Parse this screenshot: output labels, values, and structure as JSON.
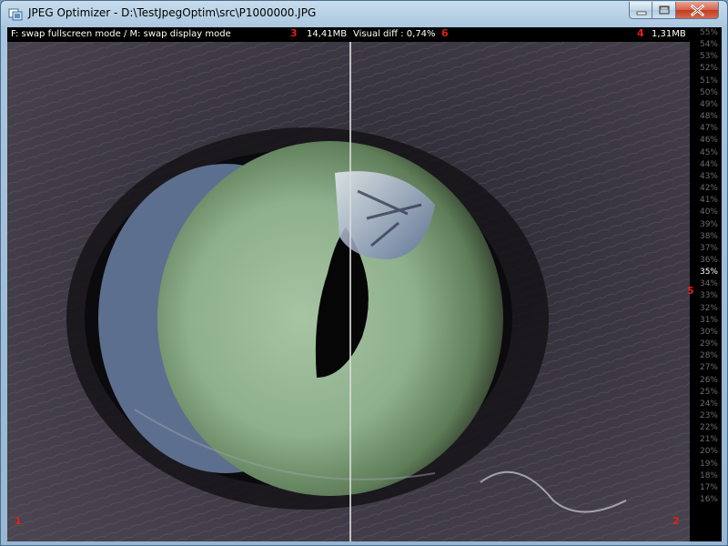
{
  "window": {
    "title": "JPEG Optimizer - D:\\TestJpegOptim\\src\\P1000000.JPG"
  },
  "toolbar": {
    "hint": "F: swap fullscreen mode / M: swap display mode",
    "marker3": "3",
    "original_size": "14,41MB",
    "visual_diff": "Visual diff : 0,74%",
    "marker6": "6",
    "marker4": "4",
    "optimized_size": "1,31MB"
  },
  "quality_scale": {
    "marker5": "5",
    "selected": "35%",
    "ticks": [
      "55%",
      "54%",
      "53%",
      "52%",
      "51%",
      "50%",
      "49%",
      "48%",
      "47%",
      "46%",
      "45%",
      "44%",
      "43%",
      "42%",
      "41%",
      "40%",
      "39%",
      "38%",
      "37%",
      "36%",
      "35%",
      "34%",
      "33%",
      "32%",
      "31%",
      "30%",
      "29%",
      "28%",
      "27%",
      "26%",
      "25%",
      "24%",
      "23%",
      "22%",
      "21%",
      "20%",
      "19%",
      "18%",
      "17%",
      "16%"
    ]
  },
  "image_view": {
    "marker1": "1",
    "marker2": "2"
  },
  "colors": {
    "marker": "#e0201a",
    "tick_inactive": "#6c6c6c",
    "tick_selected": "#ffffff",
    "fur": "#3a3640",
    "iris": "#8fb08e"
  },
  "icons": {
    "app": "app-window-icon",
    "minimize": "minimize-icon",
    "maximize": "maximize-icon",
    "close": "close-icon"
  }
}
